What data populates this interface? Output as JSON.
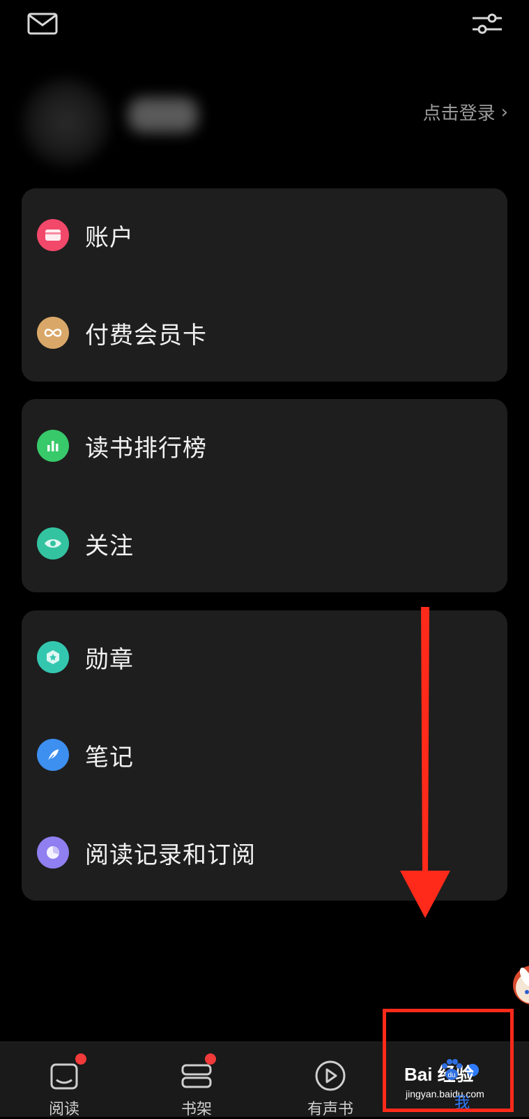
{
  "top_bar": {
    "mail_icon": "mail-icon",
    "filter_icon": "sliders-icon"
  },
  "profile": {
    "login_text": "点击登录",
    "chevron": "›"
  },
  "cards": [
    {
      "items": [
        {
          "label": "账户",
          "icon": "wallet-icon",
          "color": "#f2486a"
        },
        {
          "label": "付费会员卡",
          "icon": "infinity-icon",
          "color": "#d9a868"
        }
      ]
    },
    {
      "items": [
        {
          "label": "读书排行榜",
          "icon": "bar-chart-icon",
          "color": "#38c96a"
        },
        {
          "label": "关注",
          "icon": "eye-icon",
          "color": "#33c3a0"
        }
      ]
    },
    {
      "items": [
        {
          "label": "勋章",
          "icon": "medal-icon",
          "color": "#34c7b0"
        },
        {
          "label": "笔记",
          "icon": "feather-icon",
          "color": "#3d8ff0"
        },
        {
          "label": "阅读记录和订阅",
          "icon": "pie-chart-icon",
          "color": "#8f7ff0"
        }
      ]
    }
  ],
  "tab_bar": {
    "tabs": [
      {
        "label": "阅读",
        "icon": "book-open-icon",
        "badge": true
      },
      {
        "label": "书架",
        "icon": "bookshelf-icon",
        "badge": true
      },
      {
        "label": "有声书",
        "icon": "play-circle-icon",
        "badge": false
      },
      {
        "label": "我",
        "icon": "profile-icon",
        "badge": false,
        "active_color": "#2f7bff"
      }
    ]
  },
  "annotations": {
    "arrow_color": "#ff2a1a",
    "watermark_main": "Bai 经验",
    "watermark_paw": "du",
    "watermark_sub": "jingyan.baidu.com"
  }
}
